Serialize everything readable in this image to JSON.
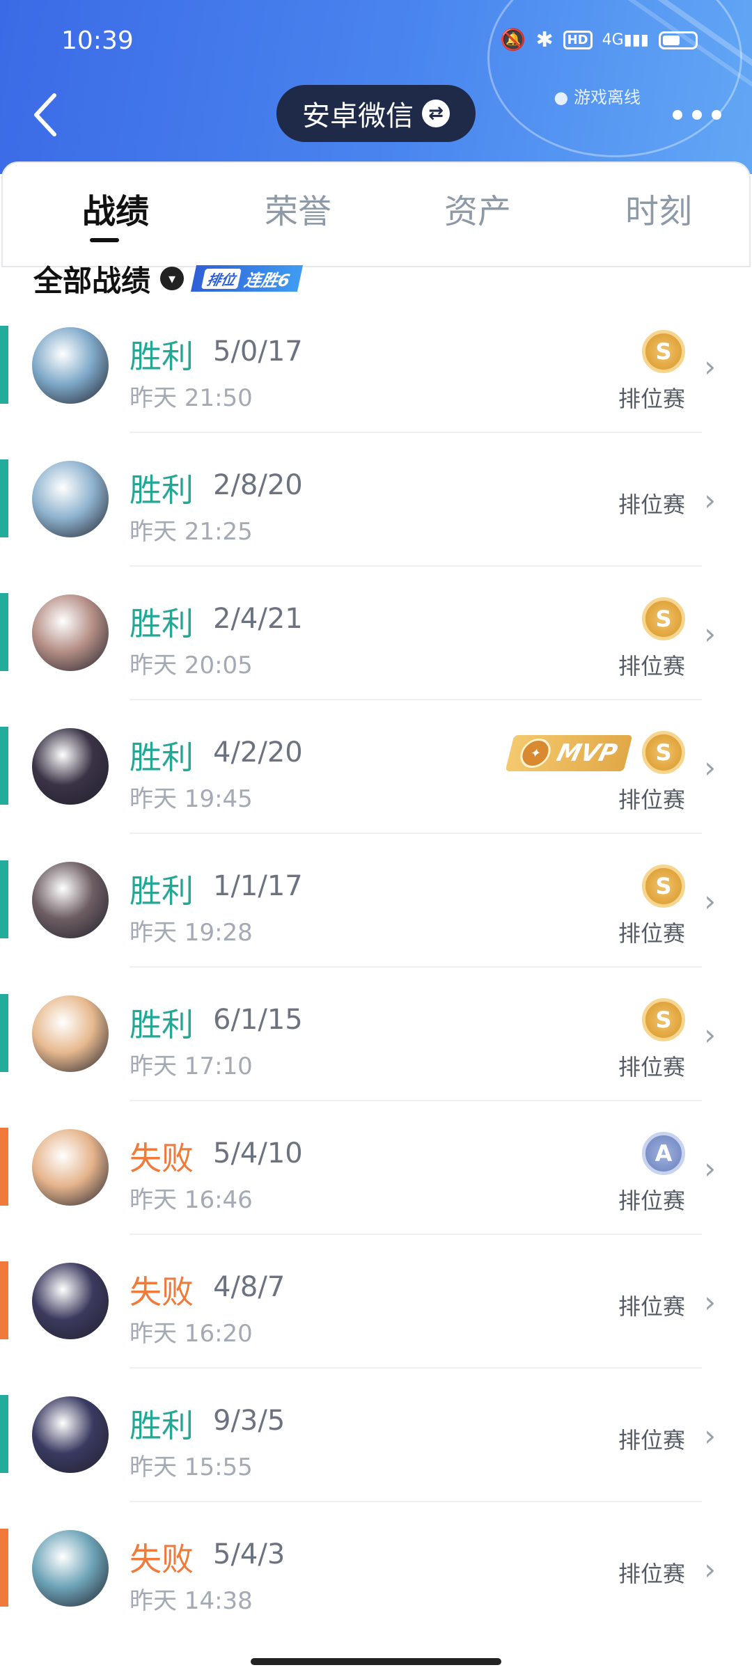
{
  "status_bar": {
    "time": "10:39",
    "network": "4G",
    "hd": "HD"
  },
  "header": {
    "offline_status": "游戏离线",
    "account_switch": "安卓微信"
  },
  "tabs": [
    {
      "label": "战绩",
      "active": true
    },
    {
      "label": "荣誉",
      "active": false
    },
    {
      "label": "资产",
      "active": false
    },
    {
      "label": "时刻",
      "active": false
    }
  ],
  "summary": {
    "label": "全部战绩",
    "streak_tag": "排位",
    "streak_text": "连胜6"
  },
  "matches": [
    {
      "result": "胜利",
      "outcome": "win",
      "kda": "5/0/17",
      "time": "昨天 21:50",
      "mode": "排位赛",
      "medal": "S",
      "mvp": false,
      "avatar_color": "#7fa9c9"
    },
    {
      "result": "胜利",
      "outcome": "win",
      "kda": "2/8/20",
      "time": "昨天 21:25",
      "mode": "排位赛",
      "medal": "",
      "mvp": false,
      "avatar_color": "#8fb3cf"
    },
    {
      "result": "胜利",
      "outcome": "win",
      "kda": "2/4/21",
      "time": "昨天 20:05",
      "mode": "排位赛",
      "medal": "S",
      "mvp": false,
      "avatar_color": "#b58f86"
    },
    {
      "result": "胜利",
      "outcome": "win",
      "kda": "4/2/20",
      "time": "昨天 19:45",
      "mode": "排位赛",
      "medal": "S",
      "mvp": true,
      "mvp_text": "MVP",
      "avatar_color": "#3a3346"
    },
    {
      "result": "胜利",
      "outcome": "win",
      "kda": "1/1/17",
      "time": "昨天 19:28",
      "mode": "排位赛",
      "medal": "S",
      "mvp": false,
      "avatar_color": "#6d5e63"
    },
    {
      "result": "胜利",
      "outcome": "win",
      "kda": "6/1/15",
      "time": "昨天 17:10",
      "mode": "排位赛",
      "medal": "S",
      "mvp": false,
      "avatar_color": "#e7b98e"
    },
    {
      "result": "失败",
      "outcome": "loss",
      "kda": "5/4/10",
      "time": "昨天 16:46",
      "mode": "排位赛",
      "medal": "A",
      "mvp": false,
      "avatar_color": "#e5b48c"
    },
    {
      "result": "失败",
      "outcome": "loss",
      "kda": "4/8/7",
      "time": "昨天 16:20",
      "mode": "排位赛",
      "medal": "",
      "mvp": false,
      "avatar_color": "#3b3a5e"
    },
    {
      "result": "胜利",
      "outcome": "win",
      "kda": "9/3/5",
      "time": "昨天 15:55",
      "mode": "排位赛",
      "medal": "",
      "mvp": false,
      "avatar_color": "#3a3a62"
    },
    {
      "result": "失败",
      "outcome": "loss",
      "kda": "5/4/3",
      "time": "昨天 14:38",
      "mode": "排位赛",
      "medal": "",
      "mvp": false,
      "avatar_color": "#6ea4b8"
    }
  ]
}
